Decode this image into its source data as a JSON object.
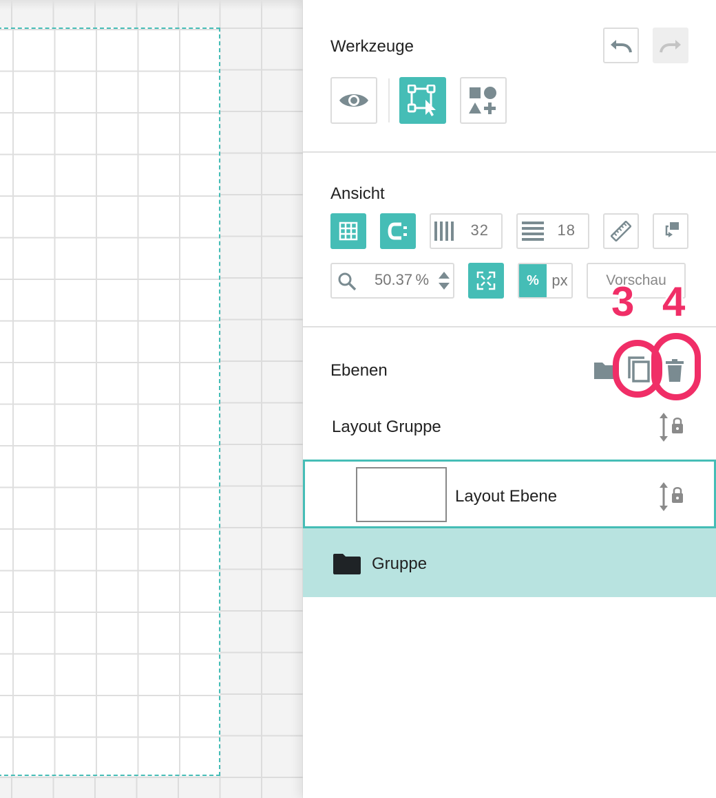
{
  "tools": {
    "title": "Werkzeuge",
    "undo_icon": "undo-icon",
    "redo_icon": "redo-icon",
    "preview_mode_icon": "eye-icon",
    "select_mode_icon": "select-transform-icon",
    "add_shapes_icon": "shapes-add-icon"
  },
  "view": {
    "title": "Ansicht",
    "columns_value": "32",
    "rows_value": "18",
    "zoom_value": "50.37 %",
    "unit_percent": "%",
    "unit_px": "px",
    "preview_label": "Vorschau"
  },
  "layers": {
    "title": "Ebenen",
    "items": [
      {
        "label": "Layout Gruppe"
      },
      {
        "label": "Layout Ebene"
      },
      {
        "label": "Gruppe"
      }
    ]
  },
  "annotations": [
    "3",
    "4"
  ],
  "colors": {
    "accent": "#45bdb6",
    "selected_row": "#b8e3e0",
    "annotation": "#f02e67"
  }
}
